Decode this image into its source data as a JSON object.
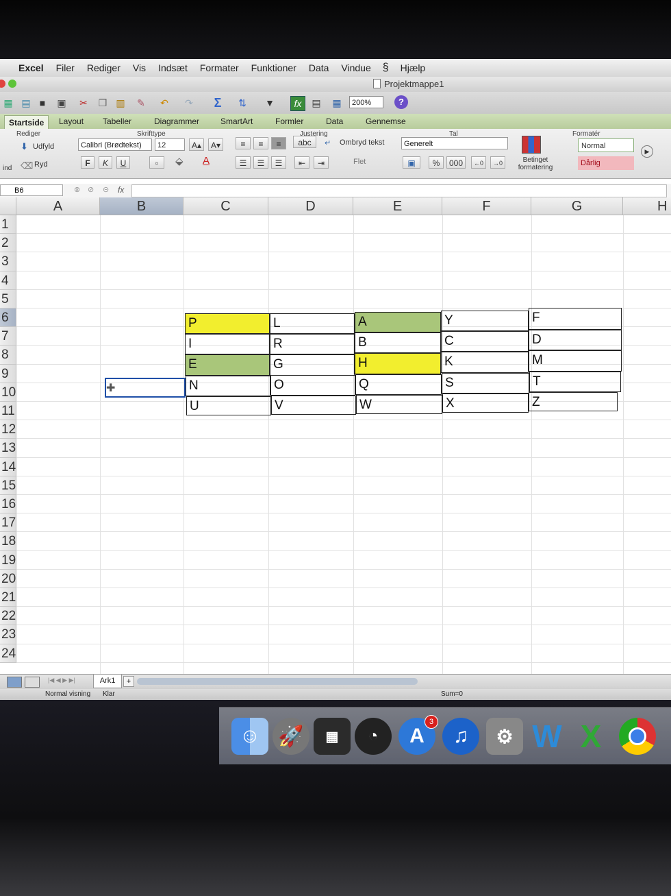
{
  "menu": {
    "items": [
      "Excel",
      "Filer",
      "Rediger",
      "Vis",
      "Indsæt",
      "Formater",
      "Funktioner",
      "Data",
      "Vindue",
      "Hjælp"
    ]
  },
  "window": {
    "title": "Projektmappe1"
  },
  "toolbar": {
    "zoom": "200%",
    "help": "?"
  },
  "ribbon_tabs": [
    "Startside",
    "Layout",
    "Tabeller",
    "Diagrammer",
    "SmartArt",
    "Formler",
    "Data",
    "Gennemse"
  ],
  "ribbon": {
    "groups": {
      "edit": "Rediger",
      "font": "Skrifttype",
      "align": "Justering",
      "number": "Tal",
      "format": "Formatér"
    },
    "fill_label": "Udfyld",
    "clear_label": "Ryd",
    "paste_label": "ind",
    "font_name": "Calibri (Brødtekst)",
    "font_size": "12",
    "bold": "F",
    "italic": "K",
    "underline": "U",
    "wrap_text": "Ombryd tekst",
    "merge": "Flet",
    "number_format": "Generelt",
    "percent": "%",
    "thousands": "000",
    "conditional_formatting": "Betinget formatering",
    "style_normal": "Normal",
    "style_bad": "Dårlig",
    "abc": "abc"
  },
  "formula_bar": {
    "cell_ref": "B6",
    "fx": "fx"
  },
  "columns": [
    "A",
    "B",
    "C",
    "D",
    "E",
    "F",
    "G",
    "H"
  ],
  "rows": [
    "1",
    "2",
    "3",
    "4",
    "5",
    "6",
    "7",
    "8",
    "9",
    "10",
    "11",
    "12",
    "13",
    "14",
    "15",
    "16",
    "17",
    "18",
    "19",
    "20",
    "21",
    "22",
    "23",
    "24"
  ],
  "grid": {
    "rows": [
      [
        "P",
        "L",
        "A",
        "Y",
        "F"
      ],
      [
        "I",
        "R",
        "B",
        "C",
        "D"
      ],
      [
        "E",
        "G",
        "H",
        "K",
        "M"
      ],
      [
        "N",
        "O",
        "Q",
        "S",
        "T"
      ],
      [
        "U",
        "V",
        "W",
        "X",
        "Z"
      ]
    ],
    "colors": {
      "yellow": "#f2ee2e",
      "green": "#a9c67a"
    }
  },
  "sheet_tabs": {
    "active": "Ark1",
    "add": "+"
  },
  "status": {
    "view": "Normal visning",
    "ready": "Klar",
    "sum": "Sum=0"
  },
  "dock": {
    "app_store_badge": "3"
  }
}
